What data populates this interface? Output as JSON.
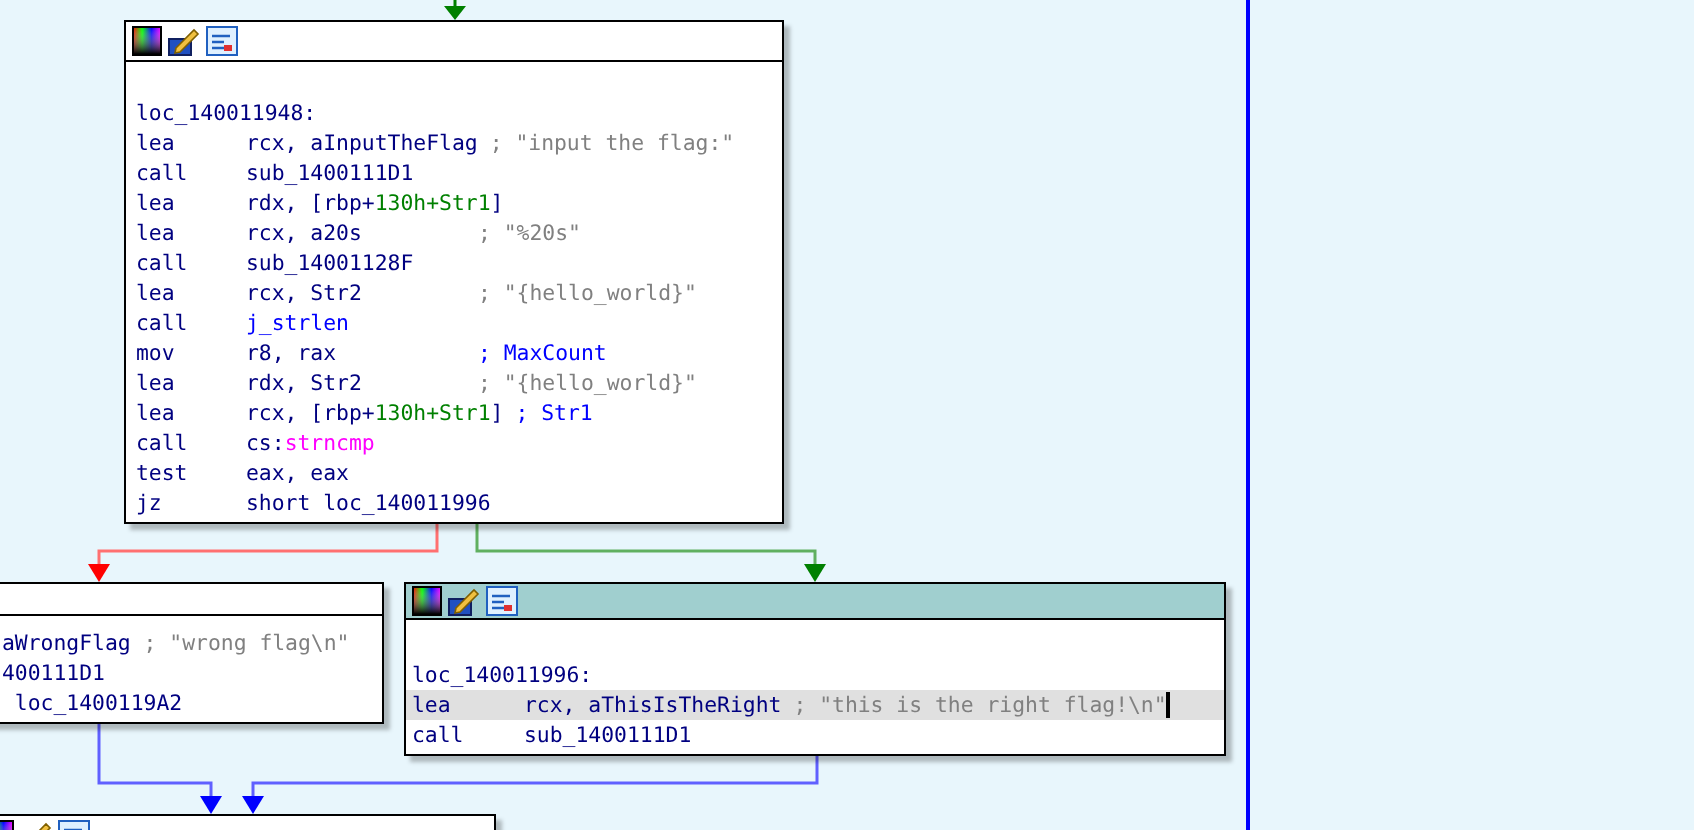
{
  "nodes": [
    {
      "selected": false,
      "lines": [
        {
          "kind": "label",
          "text": "loc_140011948:"
        },
        {
          "kind": "insn",
          "mnemonic": "lea",
          "operands": [
            {
              "kind": "plain",
              "text": "rcx, aInputTheFlag"
            }
          ],
          "comment": {
            "kind": "string",
            "text": "; \"input the flag:\""
          }
        },
        {
          "kind": "insn",
          "mnemonic": "call",
          "operands": [
            {
              "kind": "plain",
              "text": "sub_1400111D1"
            }
          ]
        },
        {
          "kind": "insn",
          "mnemonic": "lea",
          "operands": [
            {
              "kind": "plain",
              "text": "rdx, [rbp+"
            },
            {
              "kind": "stack",
              "text": "130h+Str1"
            },
            {
              "kind": "plain",
              "text": "]"
            }
          ]
        },
        {
          "kind": "insn",
          "mnemonic": "lea",
          "operands": [
            {
              "kind": "plain",
              "text": "rcx, a20s"
            }
          ],
          "comment": {
            "kind": "string",
            "text": "; \"%20s\""
          }
        },
        {
          "kind": "insn",
          "mnemonic": "call",
          "operands": [
            {
              "kind": "plain",
              "text": "sub_14001128F"
            }
          ]
        },
        {
          "kind": "insn",
          "mnemonic": "lea",
          "operands": [
            {
              "kind": "plain",
              "text": "rcx, Str2"
            }
          ],
          "comment": {
            "kind": "string",
            "text": "; \"{hello_world}\""
          }
        },
        {
          "kind": "insn",
          "mnemonic": "call",
          "operands": [
            {
              "kind": "name",
              "text": "j_strlen"
            }
          ]
        },
        {
          "kind": "insn",
          "mnemonic": "mov",
          "operands": [
            {
              "kind": "plain",
              "text": "r8, rax"
            }
          ],
          "comment": {
            "kind": "name",
            "text": "; MaxCount"
          }
        },
        {
          "kind": "insn",
          "mnemonic": "lea",
          "operands": [
            {
              "kind": "plain",
              "text": "rdx, Str2"
            }
          ],
          "comment": {
            "kind": "string",
            "text": "; \"{hello_world}\""
          }
        },
        {
          "kind": "insn",
          "mnemonic": "lea",
          "operands": [
            {
              "kind": "plain",
              "text": "rcx, [rbp+"
            },
            {
              "kind": "stack",
              "text": "130h+Str1"
            },
            {
              "kind": "plain",
              "text": "]"
            }
          ],
          "comment": {
            "kind": "name",
            "text": "; Str1"
          }
        },
        {
          "kind": "insn",
          "mnemonic": "call",
          "operands": [
            {
              "kind": "plain",
              "text": "cs:"
            },
            {
              "kind": "import",
              "text": "strncmp"
            }
          ]
        },
        {
          "kind": "insn",
          "mnemonic": "test",
          "operands": [
            {
              "kind": "plain",
              "text": "eax, eax"
            }
          ]
        },
        {
          "kind": "insn",
          "mnemonic": "jz",
          "operands": [
            {
              "kind": "plain",
              "text": "short loc_140011996"
            }
          ]
        }
      ]
    },
    {
      "selected": false,
      "lines": [
        {
          "kind": "fragment",
          "parts": [
            {
              "kind": "plain",
              "text": "aWrongFlag "
            },
            {
              "kind": "string",
              "text": "; \"wrong flag\\n\""
            }
          ]
        },
        {
          "kind": "fragment",
          "parts": [
            {
              "kind": "plain",
              "text": "400111D1"
            }
          ]
        },
        {
          "kind": "fragment",
          "parts": [
            {
              "kind": "plain",
              "text": " loc_1400119A2"
            }
          ]
        }
      ]
    },
    {
      "selected": true,
      "lines": [
        {
          "kind": "label",
          "text": "loc_140011996:"
        },
        {
          "kind": "insn",
          "highlighted": true,
          "cursor": true,
          "mnemonic": "lea",
          "operands": [
            {
              "kind": "plain",
              "text": "rcx, aThisIsTheRight"
            }
          ],
          "comment": {
            "kind": "string",
            "text": "; \"this is the right flag!\\n\""
          }
        },
        {
          "kind": "insn",
          "mnemonic": "call",
          "operands": [
            {
              "kind": "plain",
              "text": "sub_1400111D1"
            }
          ]
        }
      ]
    },
    {
      "selected": false
    }
  ]
}
